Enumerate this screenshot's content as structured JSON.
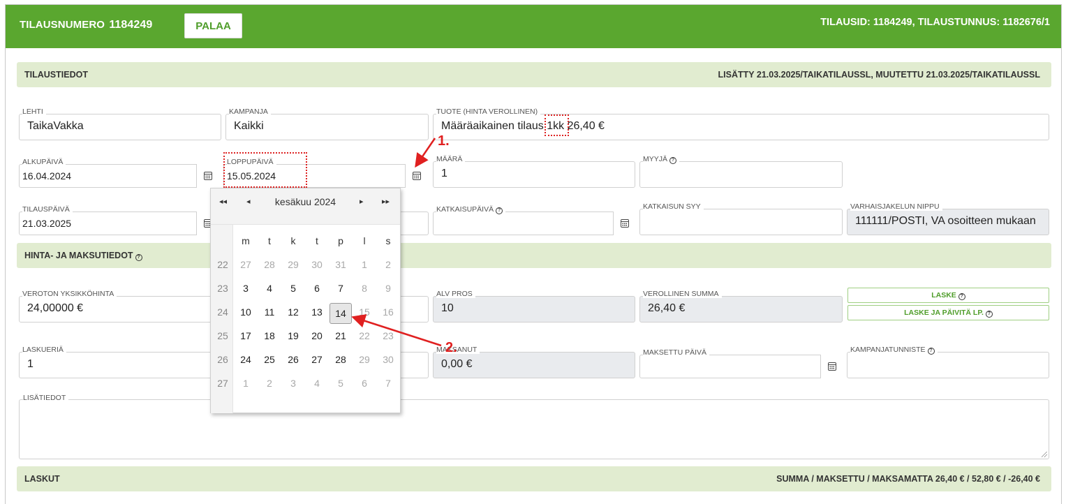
{
  "header": {
    "order_label": "TILAUSNUMERO",
    "order_number": "1184249",
    "back_button": "PALAA",
    "ids_text": "TILAUSID: 1184249, TILAUSTUNNUS: 1182676/1"
  },
  "sections": {
    "order_info": {
      "title": "TILAUSTIEDOT",
      "meta": "LISÄTTY 21.03.2025/TAIKATILAUSSL, MUUTETTU 21.03.2025/TAIKATILAUSSL"
    },
    "price_info": {
      "title": "HINTA- JA MAKSUTIEDOT"
    },
    "invoices": {
      "title": "LASKUT",
      "summary": "SUMMA / MAKSETTU / MAKSAMATTA 26,40 € / 52,80 € / -26,40 €"
    }
  },
  "fields": {
    "lehti": {
      "label": "LEHTI",
      "value": "TaikaVakka"
    },
    "kampanja": {
      "label": "KAMPANJA",
      "value": "Kaikki"
    },
    "tuote": {
      "label": "TUOTE (HINTA VEROLLINEN)",
      "value_pre": "Määräaikainen tilaus",
      "value_highlight": "1kk",
      "value_post": "26,40 €"
    },
    "alkupaiva": {
      "label": "ALKUPÄIVÄ",
      "value": "16.04.2024"
    },
    "loppupaiva": {
      "label": "LOPPUPÄIVÄ",
      "value": "15.05.2024"
    },
    "maara": {
      "label": "MÄÄRÄ",
      "value": "1"
    },
    "myyja": {
      "label": "MYYJÄ",
      "value": ""
    },
    "tilauspaiva": {
      "label": "TILAUSPÄIVÄ",
      "value": "21.03.2025"
    },
    "katkaisupaiva": {
      "label": "KATKAISUPÄIVÄ",
      "value": ""
    },
    "katkaisun_syy": {
      "label": "KATKAISUN SYY",
      "value": ""
    },
    "varhaisjakelun_nippu": {
      "label": "VARHAISJAKELUN NIPPU",
      "value": "111111/POSTI, VA osoitteen mukaan"
    },
    "veroton_yksikkohinta": {
      "label": "VEROTON YKSIKKÖHINTA",
      "value": "24,00000 €"
    },
    "alv_pros": {
      "label": "ALV PROS",
      "value": "10"
    },
    "verollinen_summa": {
      "label": "VEROLLINEN SUMMA",
      "value": "26,40 €"
    },
    "laskueria": {
      "label": "LASKUERIÄ",
      "value": "1"
    },
    "maksanut": {
      "label": "MAKSANUT",
      "value": "0,00 €"
    },
    "maksettu_paiva": {
      "label": "MAKSETTU PÄIVÄ",
      "value": ""
    },
    "kampanjatunniste": {
      "label": "KAMPANJATUNNISTE",
      "value": ""
    },
    "lisatiedot": {
      "label": "LISÄTIEDOT",
      "value": ""
    }
  },
  "buttons": {
    "laske": "LASKE",
    "laske_paivita": "LASKE JA PÄIVITÄ LP."
  },
  "datepicker": {
    "month_label": "kesäkuu 2024",
    "prev_year": "◂◂",
    "prev_month": "◂",
    "next_month": "▸",
    "next_year": "▸▸",
    "weekdays": [
      "m",
      "t",
      "k",
      "t",
      "p",
      "l",
      "s"
    ],
    "weeks": [
      {
        "wk": "22",
        "days": [
          {
            "d": "27",
            "m": true
          },
          {
            "d": "28",
            "m": true
          },
          {
            "d": "29",
            "m": true
          },
          {
            "d": "30",
            "m": true
          },
          {
            "d": "31",
            "m": true
          },
          {
            "d": "1",
            "m": true
          },
          {
            "d": "2",
            "m": true
          }
        ]
      },
      {
        "wk": "23",
        "days": [
          {
            "d": "3"
          },
          {
            "d": "4"
          },
          {
            "d": "5"
          },
          {
            "d": "6"
          },
          {
            "d": "7"
          },
          {
            "d": "8",
            "m": true
          },
          {
            "d": "9",
            "m": true
          }
        ]
      },
      {
        "wk": "24",
        "days": [
          {
            "d": "10"
          },
          {
            "d": "11"
          },
          {
            "d": "12"
          },
          {
            "d": "13"
          },
          {
            "d": "14",
            "sel": true
          },
          {
            "d": "15",
            "m": true
          },
          {
            "d": "16",
            "m": true
          }
        ]
      },
      {
        "wk": "25",
        "days": [
          {
            "d": "17"
          },
          {
            "d": "18"
          },
          {
            "d": "19"
          },
          {
            "d": "20"
          },
          {
            "d": "21"
          },
          {
            "d": "22",
            "m": true
          },
          {
            "d": "23",
            "m": true
          }
        ]
      },
      {
        "wk": "26",
        "days": [
          {
            "d": "24"
          },
          {
            "d": "25"
          },
          {
            "d": "26"
          },
          {
            "d": "27"
          },
          {
            "d": "28"
          },
          {
            "d": "29",
            "m": true
          },
          {
            "d": "30",
            "m": true
          }
        ]
      },
      {
        "wk": "27",
        "days": [
          {
            "d": "1",
            "m": true
          },
          {
            "d": "2",
            "m": true
          },
          {
            "d": "3",
            "m": true
          },
          {
            "d": "4",
            "m": true
          },
          {
            "d": "5",
            "m": true
          },
          {
            "d": "6",
            "m": true
          },
          {
            "d": "7",
            "m": true
          }
        ]
      }
    ]
  },
  "annotations": {
    "one": "1.",
    "two": "2."
  },
  "colors": {
    "header_green": "#5aa72f",
    "section_bg": "#e1ecd0",
    "annotation_red": "#e02020"
  }
}
